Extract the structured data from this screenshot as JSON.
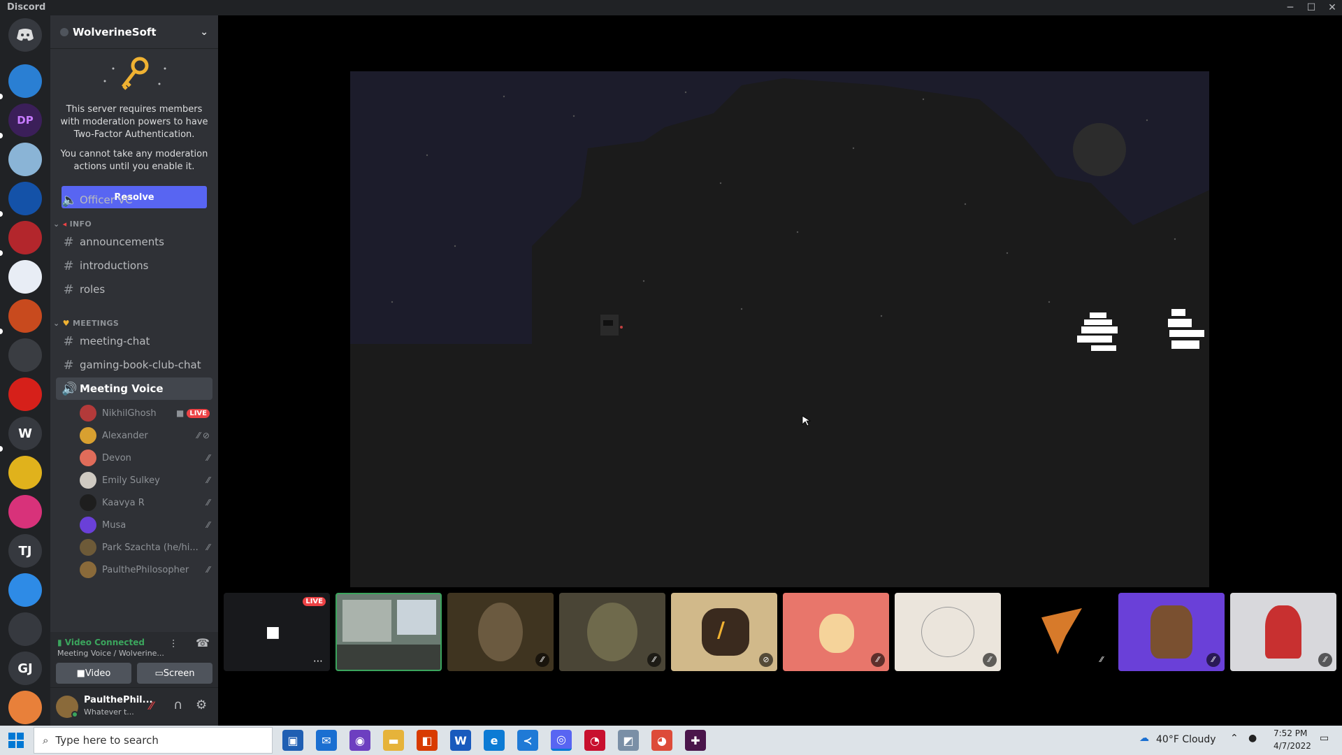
{
  "window": {
    "title": "Discord"
  },
  "server": {
    "name": "WolverineSoft"
  },
  "notice": {
    "line1": "This server requires members with moderation powers to have Two-Factor Authentication.",
    "line2": "You cannot take any moderation actions until you enable it.",
    "resolve_label": "Resolve"
  },
  "channels": {
    "officer_vc": "Officer VC",
    "info_category": "INFO",
    "announcements": "announcements",
    "introductions": "introductions",
    "roles": "roles",
    "meetings_category": "MEETINGS",
    "meeting_chat": "meeting-chat",
    "gaming_book_club_chat": "gaming-book-club-chat",
    "meeting_voice": "Meeting Voice"
  },
  "voice_members": [
    {
      "name": "NikhilGhosh",
      "badge": "LIVE"
    },
    {
      "name": "Alexander"
    },
    {
      "name": "Devon"
    },
    {
      "name": "Emily Sulkey"
    },
    {
      "name": "Kaavya R"
    },
    {
      "name": "Musa"
    },
    {
      "name": "Park Szachta (he/hi..."
    },
    {
      "name": "PaulthePhilosopher"
    }
  ],
  "voice_panel": {
    "status": "Video Connected",
    "subtitle": "Meeting Voice / Wolverine...",
    "video_label": "Video",
    "screen_label": "Screen"
  },
  "user_panel": {
    "username": "PaulthePhil...",
    "status": "Whatever t..."
  },
  "servers": [
    {
      "label": ""
    },
    {
      "label": "DP"
    },
    {
      "label": ""
    },
    {
      "label": ""
    },
    {
      "label": ""
    },
    {
      "label": ""
    },
    {
      "label": ""
    },
    {
      "label": ""
    },
    {
      "label": ""
    },
    {
      "label": "W"
    },
    {
      "label": ""
    },
    {
      "label": ""
    },
    {
      "label": "TJ"
    },
    {
      "label": ""
    },
    {
      "label": ""
    },
    {
      "label": "GJ"
    },
    {
      "label": ""
    }
  ],
  "stream_tiles": [
    {
      "type": "camera-off",
      "badge": "LIVE"
    },
    {
      "type": "classroom"
    },
    {
      "type": "person"
    },
    {
      "type": "character"
    },
    {
      "type": "pencil"
    },
    {
      "type": "chicken"
    },
    {
      "type": "sketch"
    },
    {
      "type": "dragon"
    },
    {
      "type": "pixel-face"
    },
    {
      "type": "anime"
    }
  ],
  "taskbar": {
    "search_placeholder": "Type here to search",
    "weather": "40°F  Cloudy",
    "time": "7:52 PM",
    "date": "4/7/2022"
  },
  "colors": {
    "accent": "#5865f2",
    "online": "#3ba55d",
    "live": "#ed4245",
    "sidebar": "#2f3136",
    "rail": "#202225"
  }
}
